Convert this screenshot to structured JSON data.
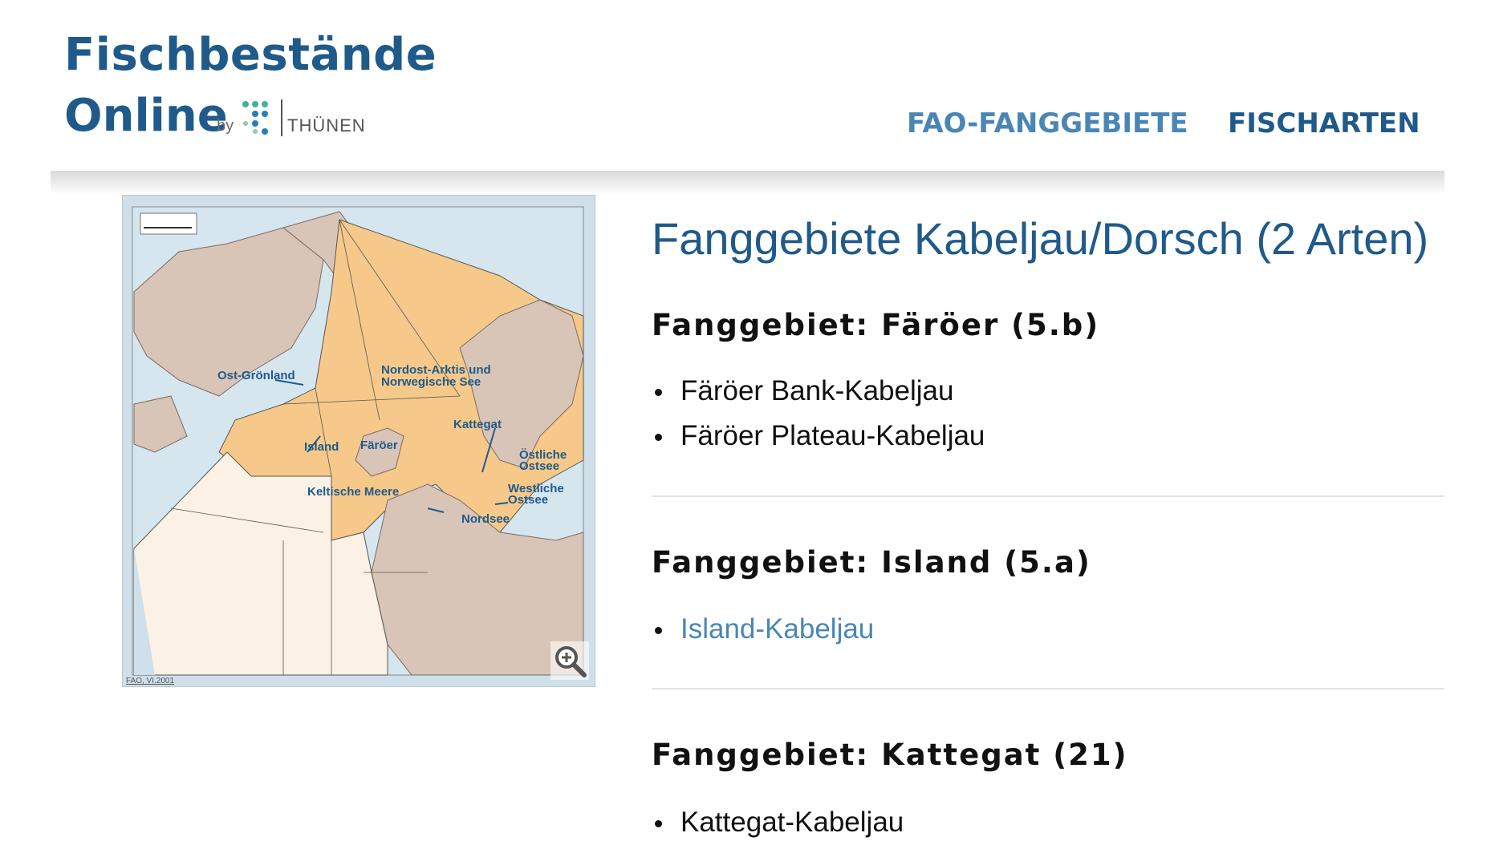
{
  "header": {
    "logo_line1": "Fischbestände",
    "logo_line2": "Online",
    "by": "by",
    "partner": "THÜNEN",
    "nav": [
      "FAO-FANGGEBIETE",
      "FISCHARTEN"
    ]
  },
  "map": {
    "labels": {
      "ost_groenland": "Ost-Grönland",
      "nordost_line1": "Nordost-Arktis und",
      "nordost_line2": "Norwegische See",
      "kattegat": "Kattegat",
      "island": "Island",
      "faroer": "Färöer",
      "oestliche1": "Östliche",
      "oestliche2": "Ostsee",
      "keltische": "Keltische Meere",
      "westliche1": "Westliche",
      "westliche2": "Ostsee",
      "nordsee": "Nordsee",
      "source": "FAO, VI.2001"
    },
    "colors": {
      "sea": "#cfe0ea",
      "land": "#d9c5b8",
      "highlight": "#f6c98a",
      "area": "#fbf1e4"
    },
    "zoom_icon": "zoom-in-icon"
  },
  "content": {
    "title": "Fanggebiete Kabeljau/Dorsch (2 Arten)",
    "sections": [
      {
        "heading": "Fanggebiet: Färöer (5.b)",
        "items": [
          "Färöer Bank-Kabeljau",
          "Färöer Plateau-Kabeljau"
        ]
      },
      {
        "heading": "Fanggebiet: Island (5.a)",
        "items": [
          "Island-Kabeljau"
        ]
      },
      {
        "heading": "Fanggebiet: Kattegat (21)",
        "items": [
          "Kattegat-Kabeljau"
        ]
      }
    ]
  },
  "colors": {
    "brand": "#1f5a8a",
    "link": "#4a86b5"
  }
}
